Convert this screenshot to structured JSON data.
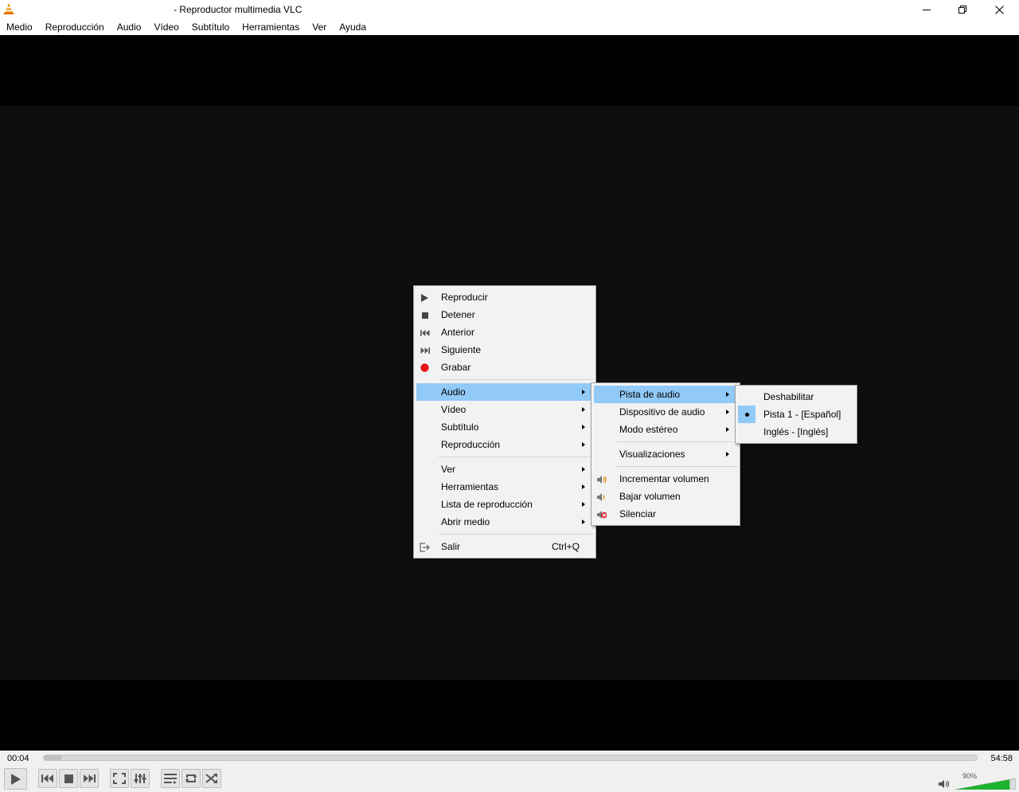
{
  "window": {
    "title": "- Reproductor multimedia VLC",
    "icon": "vlc-cone-icon"
  },
  "menubar": [
    "Medio",
    "Reproducción",
    "Audio",
    "Vídeo",
    "Subtítulo",
    "Herramientas",
    "Ver",
    "Ayuda"
  ],
  "context_menu": {
    "playback": [
      {
        "label": "Reproducir",
        "icon": "play-icon"
      },
      {
        "label": "Detener",
        "icon": "stop-icon"
      },
      {
        "label": "Anterior",
        "icon": "previous-icon"
      },
      {
        "label": "Siguiente",
        "icon": "next-icon"
      },
      {
        "label": "Grabar",
        "icon": "record-icon"
      }
    ],
    "media": [
      {
        "label": "Audio"
      },
      {
        "label": "Vídeo"
      },
      {
        "label": "Subtítulo"
      },
      {
        "label": "Reproducción"
      }
    ],
    "tools": [
      {
        "label": "Ver"
      },
      {
        "label": "Herramientas"
      },
      {
        "label": "Lista de reproducción"
      },
      {
        "label": "Abrir medio"
      }
    ],
    "quit": {
      "label": "Salir",
      "shortcut": "Ctrl+Q",
      "icon": "exit-icon"
    }
  },
  "audio_submenu": {
    "tracks_group": [
      {
        "label": "Pista de audio"
      },
      {
        "label": "Dispositivo de audio"
      },
      {
        "label": "Modo estéreo"
      }
    ],
    "visualizations": {
      "label": "Visualizaciones"
    },
    "volume_group": [
      {
        "label": "Incrementar volumen",
        "icon": "volume-up-icon"
      },
      {
        "label": "Bajar volumen",
        "icon": "volume-down-icon"
      },
      {
        "label": "Silenciar",
        "icon": "mute-icon"
      }
    ]
  },
  "audio_track_submenu": {
    "items": [
      {
        "label": "Deshabilitar",
        "selected": false
      },
      {
        "label": "Pista 1 - [Español]",
        "selected": true
      },
      {
        "label": "Inglés - [Inglés]",
        "selected": false
      }
    ]
  },
  "controls": {
    "elapsed": "00:04",
    "total": "54:58",
    "progress_fraction": 0.0012,
    "volume_label": "90%",
    "volume_fraction": 0.9,
    "volume_color": "#1db22d",
    "highlight_color": "#91c9f7"
  }
}
